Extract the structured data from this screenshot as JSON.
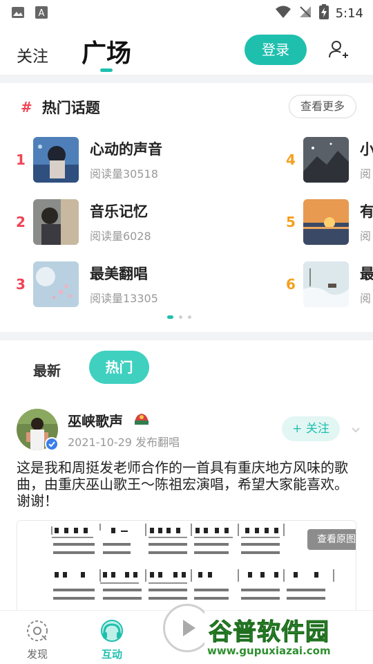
{
  "status_bar": {
    "time": "5:14"
  },
  "top_nav": {
    "follow_tab": "关注",
    "square_tab": "广场",
    "login_button": "登录"
  },
  "topics": {
    "title": "热门话题",
    "hash": "#",
    "more_button": "查看更多",
    "items": [
      {
        "rank": "1",
        "name": "心动的声音",
        "reads": "阅读量30518"
      },
      {
        "rank": "2",
        "name": "音乐记忆",
        "reads": "阅读量6028"
      },
      {
        "rank": "3",
        "name": "最美翻唱",
        "reads": "阅读量13305"
      },
      {
        "rank": "4",
        "name": "小",
        "reads": "阅"
      },
      {
        "rank": "5",
        "name": "有",
        "reads": "阅"
      },
      {
        "rank": "6",
        "name": "最",
        "reads": "阅"
      }
    ],
    "pager": {
      "count": 3,
      "active": 1
    }
  },
  "feed": {
    "tab_new": "最新",
    "tab_hot": "热门",
    "post": {
      "author": "巫峡歌声",
      "meta": "2021-10-29 发布翻唱",
      "follow_button": "+ 关注",
      "text": "这是我和周挺发老师合作的一首具有重庆地方风味的歌曲，由重庆巫山歌王～陈祖宏演唱，希望大家能喜欢。谢谢！",
      "view_original": "查看原图"
    }
  },
  "bottom_nav": {
    "discover": "发现",
    "interact": "互动"
  },
  "watermark": {
    "title": "谷普软件园",
    "url": "www.gupuxiazai.com"
  },
  "colors": {
    "accent": "#1fbfae",
    "rank_top": "#f04455",
    "rank_other": "#f4a020"
  }
}
